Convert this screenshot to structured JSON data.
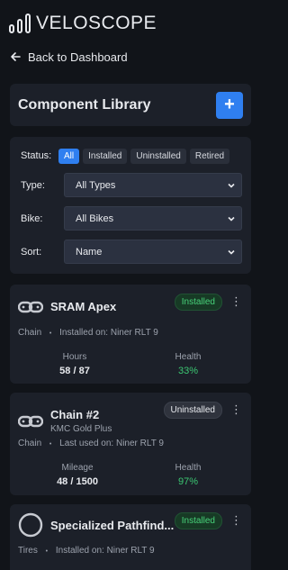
{
  "app": {
    "name": "VELOSCOPE"
  },
  "nav": {
    "back_label": "Back to Dashboard"
  },
  "page": {
    "title": "Component Library",
    "add_label": "+"
  },
  "filters": {
    "status_label": "Status:",
    "status_options": [
      "All",
      "Installed",
      "Uninstalled",
      "Retired"
    ],
    "status_selected": "All",
    "type_label": "Type:",
    "type_value": "All Types",
    "bike_label": "Bike:",
    "bike_value": "All Bikes",
    "sort_label": "Sort:",
    "sort_value": "Name"
  },
  "components": [
    {
      "name": "SRAM Apex",
      "model": "",
      "icon": "chain-icon",
      "status": "Installed",
      "category": "Chain",
      "location": "Installed on: Niner RLT 9",
      "stat1_label": "Hours",
      "stat1_value": "58 / 87",
      "stat2_label": "Health",
      "stat2_value": "33%"
    },
    {
      "name": "Chain #2",
      "model": "KMC Gold Plus",
      "icon": "chain-icon",
      "status": "Uninstalled",
      "category": "Chain",
      "location": "Last used on: Niner RLT 9",
      "stat1_label": "Mileage",
      "stat1_value": "48 / 1500",
      "stat2_label": "Health",
      "stat2_value": "97%"
    },
    {
      "name": "Specialized Pathfind...",
      "model": "",
      "icon": "tire-icon",
      "status": "Installed",
      "category": "Tires",
      "location": "Installed on: Niner RLT 9"
    }
  ],
  "colors": {
    "accent": "#2f7ff0",
    "health_good": "#3bc672",
    "installed_badge": "#48d27a"
  },
  "separator": "•",
  "menu_glyph": "⋮"
}
